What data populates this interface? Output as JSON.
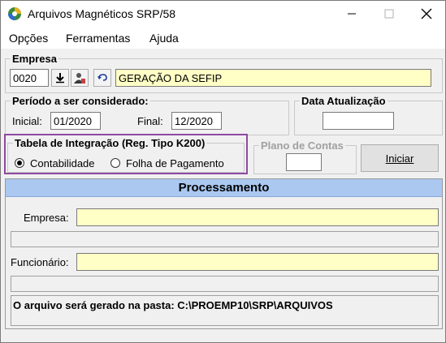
{
  "window": {
    "title": "Arquivos Magnéticos SRP/58",
    "icon": "app-globe-icon",
    "controls": [
      "minimize-icon",
      "maximize-icon",
      "close-icon"
    ]
  },
  "menu": {
    "items": [
      {
        "label": "Opções"
      },
      {
        "label": "Ferramentas"
      },
      {
        "label": "Ajuda"
      }
    ]
  },
  "empresa": {
    "legend": "Empresa",
    "code": "0020",
    "name": "GERAÇÃO DA SEFIP",
    "buttons": [
      "download-icon",
      "user-lookup-icon",
      "undo-icon"
    ]
  },
  "periodo": {
    "legend": "Período a ser considerado:",
    "inicial_label": "Inicial:",
    "inicial_value": "01/2020",
    "final_label": "Final:",
    "final_value": "12/2020"
  },
  "data_atualizacao": {
    "legend": "Data Atualização",
    "value": ""
  },
  "tabela": {
    "legend": "Tabela de Integração (Reg. Tipo K200)",
    "options": [
      {
        "label": "Contabilidade",
        "selected": true
      },
      {
        "label": "Folha de Pagamento",
        "selected": false
      }
    ]
  },
  "plano": {
    "legend": "Plano de Contas",
    "value": ""
  },
  "actions": {
    "iniciar_label": "Iniciar"
  },
  "processamento": {
    "header": "Processamento",
    "empresa_label": "Empresa:",
    "empresa_value": "",
    "funcionario_label": "Funcionário:",
    "funcionario_value": "",
    "message": "O arquivo será gerado na pasta: C:\\PROEMP10\\SRP\\ARQUIVOS"
  },
  "colors": {
    "highlight": "#8e4aa0",
    "header_bg": "#aac8f0",
    "input_yellow": "#ffffc6"
  }
}
